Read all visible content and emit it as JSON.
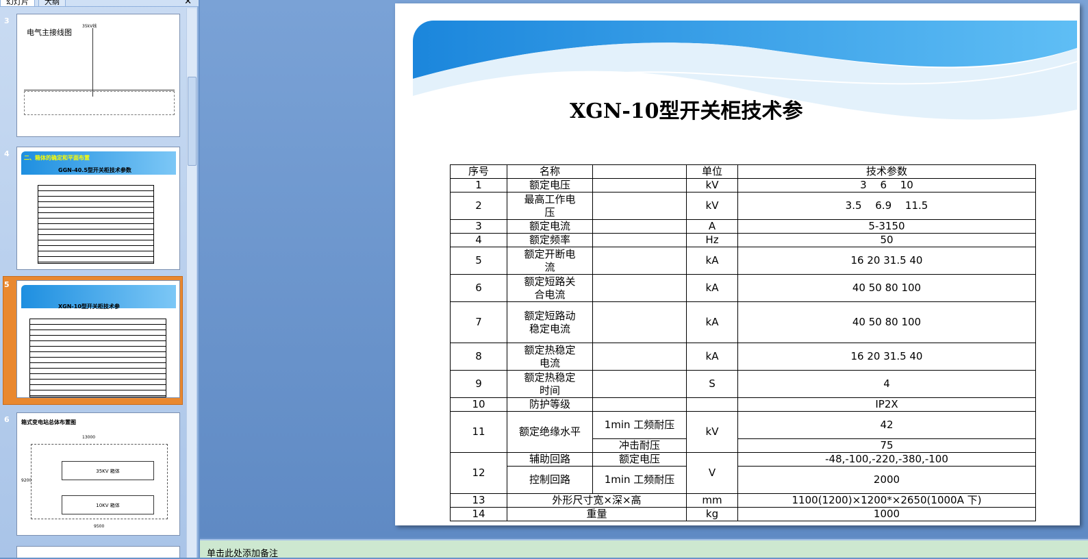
{
  "panel": {
    "tabs": [
      "幻灯片",
      "大纲"
    ],
    "close": "✕"
  },
  "thumbnails": [
    {
      "num": "3",
      "title": "电气主接线图",
      "sub": "35kV线"
    },
    {
      "num": "4",
      "title": "二、箱体的确定和平面布置",
      "sub": "GGN-40.5型开关柜技术参数"
    },
    {
      "num": "5",
      "title": "XGN-10型开关柜技术参"
    },
    {
      "num": "6",
      "title": "箱式变电站总体布置图",
      "labels": [
        "35KV 箱体",
        "10KV 箱体",
        "9200",
        "13000",
        "9500"
      ]
    }
  ],
  "slide": {
    "title": "XGN-10型开关柜技术参",
    "header": [
      "序号",
      "名称",
      "单位",
      "技术参数"
    ],
    "rows": [
      [
        "1",
        "额定电压",
        "kV",
        "3　 6　 10"
      ],
      [
        "2",
        "最高工作电压",
        "kV",
        "3.5　 6.9　 11.5"
      ],
      [
        "3",
        "额定电流",
        "A",
        "5-3150"
      ],
      [
        "4",
        "额定频率",
        "Hz",
        "50"
      ],
      [
        "5",
        "额定开断电流",
        "kA",
        "16 20 31.5 40"
      ],
      [
        "6",
        "额定短路关合电流",
        "kA",
        "40 50 80 100"
      ],
      [
        "7",
        "额定短路动稳定电流",
        "kA",
        "40 50 80 100"
      ],
      [
        "8",
        "额定热稳定电流",
        "kA",
        "16 20 31.5 40"
      ],
      [
        "9",
        "额定热稳定时间",
        "S",
        "4"
      ],
      [
        "10",
        "防护等级",
        "",
        "IP2X"
      ]
    ],
    "r11": {
      "num": "11",
      "name": "额定绝缘水平",
      "sub1": "1min 工频耐压",
      "sub2": "冲击耐压",
      "unit": "kV",
      "v1": "42",
      "v2": "75"
    },
    "r12": {
      "num": "12",
      "name1": "辅助回路",
      "sub1": "额定电压",
      "name2": "控制回路",
      "sub2": "1min 工频耐压",
      "unit": "V",
      "v1": "-48,-100,-220,-380,-100",
      "v2": "2000"
    },
    "r13": {
      "num": "13",
      "name": "外形尺寸宽×深×高",
      "unit": "mm",
      "value": "1100(1200)×1200*×2650(1000A 下)"
    },
    "r14": {
      "num": "14",
      "name": "重量",
      "unit": "kg",
      "value": "1000"
    }
  },
  "notes": {
    "placeholder": "单击此处添加备注"
  }
}
